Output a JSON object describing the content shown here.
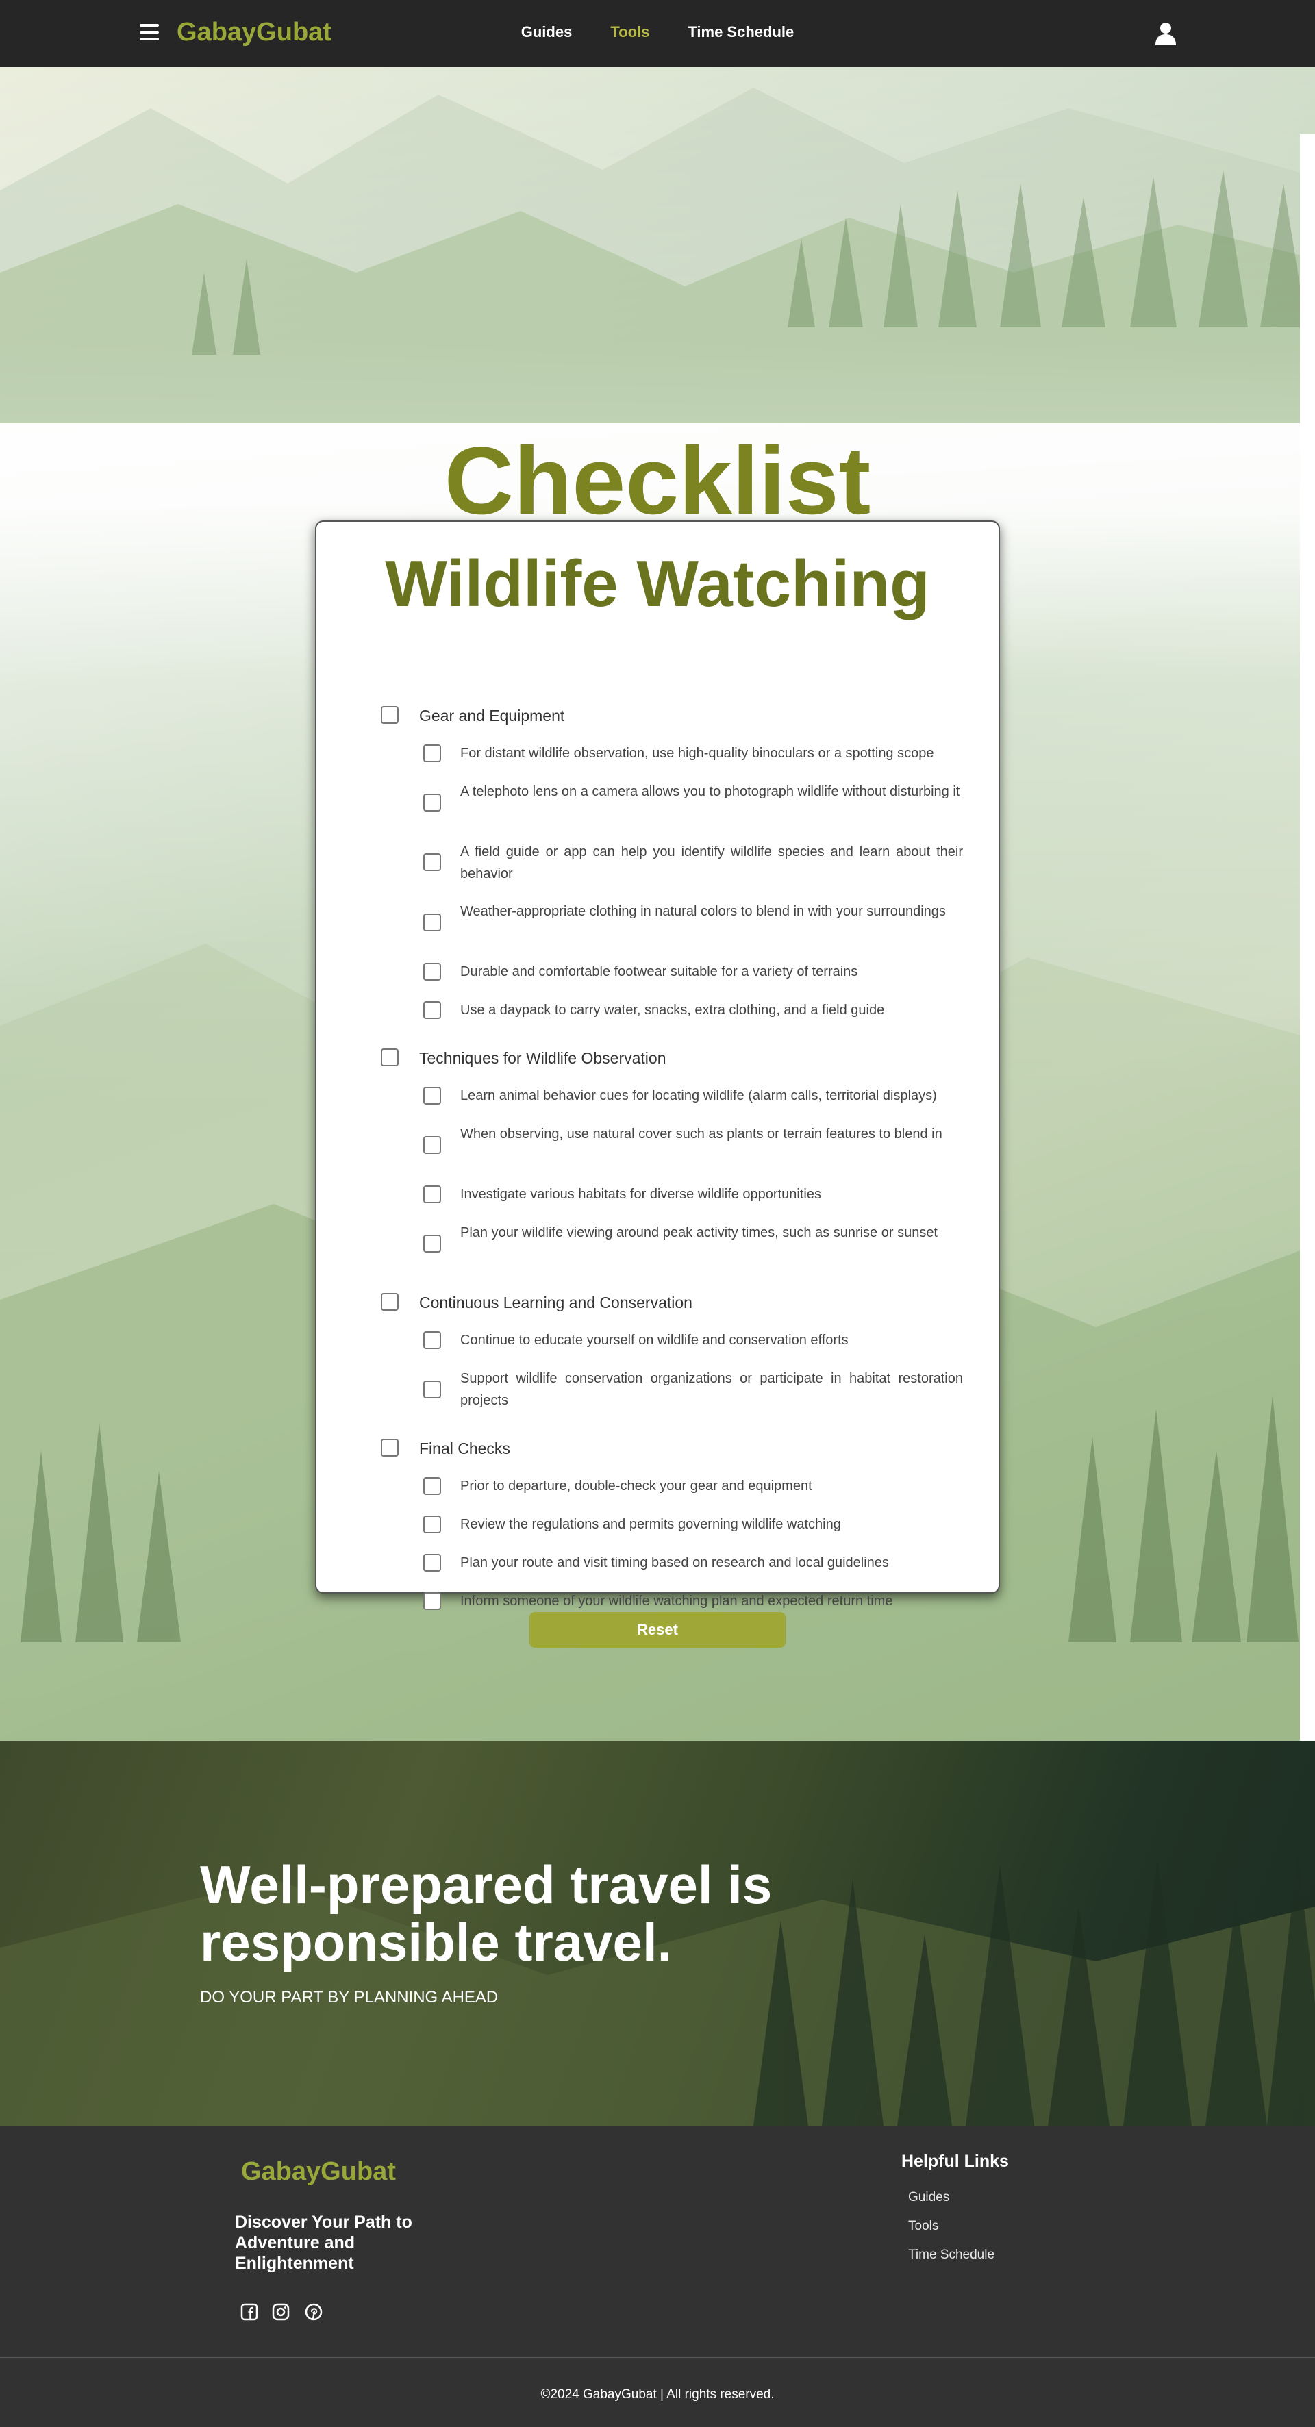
{
  "header": {
    "brand": "GabayGubat",
    "nav": [
      {
        "label": "Guides",
        "active": false
      },
      {
        "label": "Tools",
        "active": true
      },
      {
        "label": "Time Schedule",
        "active": false
      }
    ],
    "icons": {
      "menu": "hamburger-menu-icon",
      "user": "user-icon"
    }
  },
  "hero": {
    "title": "Checklist"
  },
  "checklist": {
    "title": "Wildlife Watching",
    "sections": [
      {
        "label": "Gear and Equipment",
        "items": [
          "For distant wildlife observation, use high-quality binoculars or a spotting scope",
          "A telephoto lens on a camera allows you to photograph wildlife without disturbing it",
          "A field guide or app can help you identify wildlife species and learn about their behavior",
          "Weather-appropriate clothing in natural colors to blend in with your surroundings",
          "Durable and comfortable footwear suitable for a variety of terrains",
          "Use a daypack to carry water, snacks, extra clothing, and a field guide"
        ]
      },
      {
        "label": "Techniques for Wildlife Observation",
        "items": [
          "Learn animal behavior cues for locating wildlife (alarm calls, territorial displays)",
          "When observing, use natural cover such as plants or terrain features to blend in",
          "Investigate various habitats for diverse wildlife opportunities",
          "Plan your wildlife viewing around peak activity times, such as sunrise or sunset"
        ]
      },
      {
        "label": "Continuous Learning and Conservation",
        "items": [
          "Continue to educate yourself on wildlife and conservation efforts",
          "Support wildlife conservation organizations or participate in habitat restoration projects"
        ]
      },
      {
        "label": "Final Checks",
        "items": [
          "Prior to departure, double-check your gear and equipment",
          "Review the regulations and permits governing wildlife watching",
          "Plan your route and visit timing based on research and local guidelines",
          "Inform someone of your wildlife watching plan and expected return time"
        ]
      }
    ],
    "reset_label": "Reset"
  },
  "banner": {
    "title": "Well-prepared travel is responsible travel.",
    "subtitle": "DO YOUR PART BY PLANNING AHEAD"
  },
  "footer": {
    "brand": "GabayGubat",
    "tagline": "Discover Your Path to Adventure and Enlightenment",
    "social_icons": [
      "facebook-icon",
      "instagram-icon",
      "pinterest-icon"
    ],
    "links_heading": "Helpful Links",
    "links": [
      "Guides",
      "Tools",
      "Time Schedule"
    ],
    "copyright": "©2024 GabayGubat | All rights reserved."
  },
  "colors": {
    "accent": "#9aa83a",
    "active_nav": "#b7b845",
    "title_olive": "#7b8421",
    "header_bg": "#262626",
    "footer_bg": "#323232",
    "reset_bg": "#9fa837"
  }
}
